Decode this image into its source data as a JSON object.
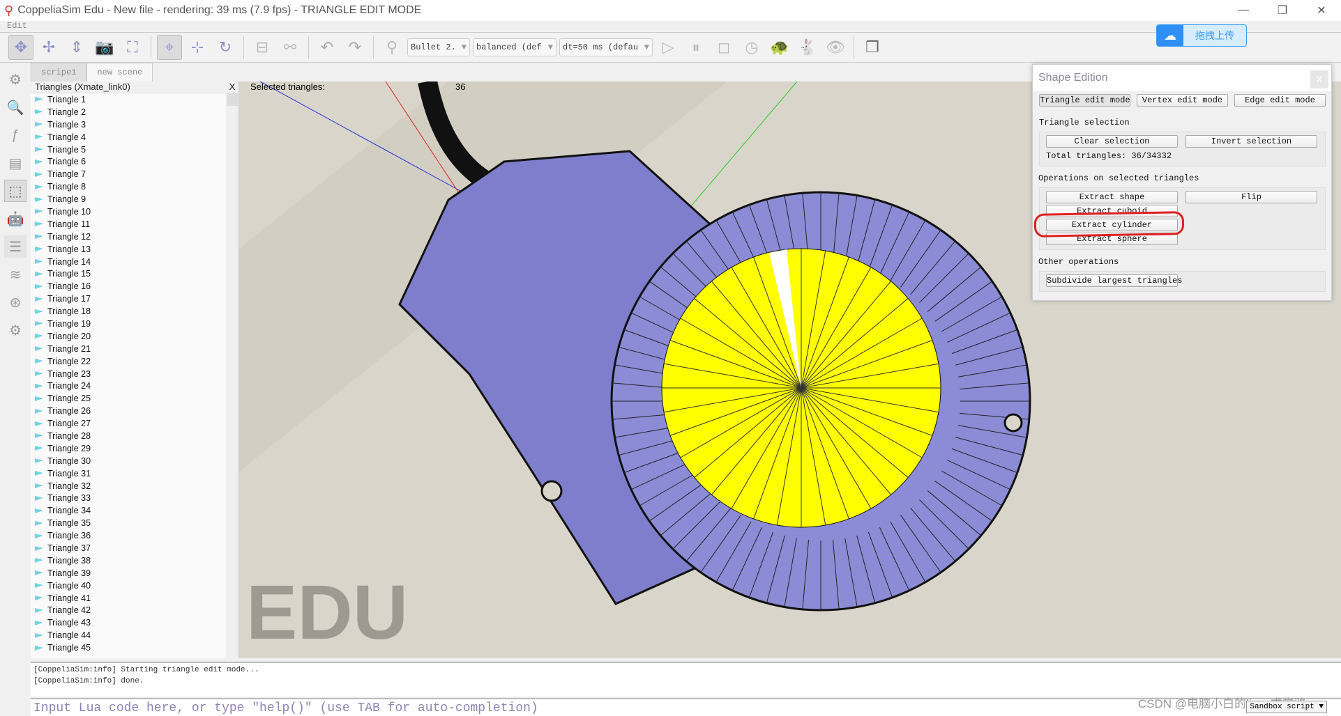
{
  "window": {
    "title": "CoppeliaSim Edu - New file - rendering: 39 ms (7.9 fps) - TRIANGLE EDIT MODE",
    "minimize": "—",
    "restore": "❐",
    "close": "✕"
  },
  "menu": {
    "edit": "Edit"
  },
  "toolbar": {
    "engine": "Bullet 2.",
    "accuracy": "balanced (def",
    "dt": "dt=50 ms (defau",
    "combo_arrow": "▼"
  },
  "upload_widget": {
    "label": "拖拽上传"
  },
  "tabs": [
    {
      "label": "scripe1"
    },
    {
      "label": "new scene"
    }
  ],
  "tree": {
    "title": "Triangles (Xmate_link0)",
    "close": "X",
    "items": [
      "Triangle 1",
      "Triangle 2",
      "Triangle 3",
      "Triangle 4",
      "Triangle 5",
      "Triangle 6",
      "Triangle 7",
      "Triangle 8",
      "Triangle 9",
      "Triangle 10",
      "Triangle 11",
      "Triangle 12",
      "Triangle 13",
      "Triangle 14",
      "Triangle 15",
      "Triangle 16",
      "Triangle 17",
      "Triangle 18",
      "Triangle 19",
      "Triangle 20",
      "Triangle 21",
      "Triangle 22",
      "Triangle 23",
      "Triangle 24",
      "Triangle 25",
      "Triangle 26",
      "Triangle 27",
      "Triangle 28",
      "Triangle 29",
      "Triangle 30",
      "Triangle 31",
      "Triangle 32",
      "Triangle 33",
      "Triangle 34",
      "Triangle 35",
      "Triangle 36",
      "Triangle 37",
      "Triangle 38",
      "Triangle 39",
      "Triangle 40",
      "Triangle 41",
      "Triangle 42",
      "Triangle 43",
      "Triangle 44",
      "Triangle 45"
    ]
  },
  "viewport": {
    "selected_label": "Selected triangles:",
    "selected_count": "36",
    "watermark": "EDU",
    "colors": {
      "shape": "#8b8bd6",
      "selection": "#ffff00",
      "background": "#d9d4c8"
    }
  },
  "dialog": {
    "title": "Shape Edition",
    "close": "x",
    "modes": [
      "Triangle edit mode",
      "Vertex edit mode",
      "Edge edit mode"
    ],
    "selection_header": "Triangle selection",
    "clear": "Clear selection",
    "invert": "Invert selection",
    "total": "Total triangles: 36/34332",
    "ops_header": "Operations on selected triangles",
    "extract_shape": "Extract shape",
    "flip": "Flip",
    "extract_cuboid": "Extract cuboid",
    "extract_cylinder": "Extract cylinder",
    "extract_sphere": "Extract sphere",
    "other_header": "Other operations",
    "subdivide": "Subdivide largest triangles",
    "annotation_color": "#e02020"
  },
  "console": {
    "lines": [
      "[CoppeliaSim:info] Starting  triangle  edit  mode...",
      "[CoppeliaSim:info] done."
    ]
  },
  "lua": {
    "placeholder": "Input Lua code here, or type \"help()\" (use TAB for auto-completion)",
    "sandbox": "Sandbox script ▼"
  },
  "watermark": "CSDN @电脑小白的linux求学路"
}
